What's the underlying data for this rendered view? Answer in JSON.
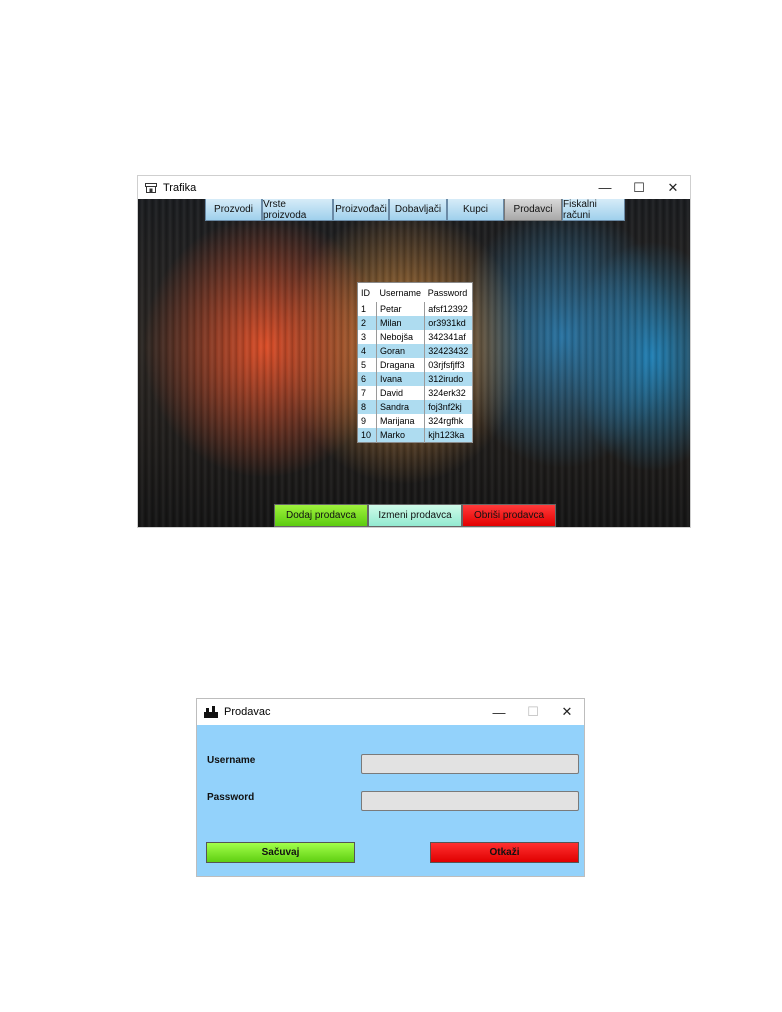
{
  "window_main": {
    "title": "Trafika",
    "controls": {
      "minimize": "—",
      "maximize": "☐",
      "close": "✕"
    },
    "tabs": [
      {
        "label": "Prozvodi",
        "active": false
      },
      {
        "label": "Vrste proizvoda",
        "active": false
      },
      {
        "label": "Proizvođači",
        "active": false
      },
      {
        "label": "Dobavljači",
        "active": false
      },
      {
        "label": "Kupci",
        "active": false
      },
      {
        "label": "Prodavci",
        "active": true
      },
      {
        "label": "Fiskalni računi",
        "active": false
      }
    ],
    "table": {
      "headers": [
        "ID",
        "Username",
        "Password"
      ],
      "rows": [
        [
          "1",
          "Petar",
          "afsf12392"
        ],
        [
          "2",
          "Milan",
          "or3931kd"
        ],
        [
          "3",
          "Nebojša",
          "342341af"
        ],
        [
          "4",
          "Goran",
          "32423432"
        ],
        [
          "5",
          "Dragana",
          "03rjfsfjff3"
        ],
        [
          "6",
          "Ivana",
          "312irudo"
        ],
        [
          "7",
          "David",
          "324erk32"
        ],
        [
          "8",
          "Sandra",
          "foj3nf2kj"
        ],
        [
          "9",
          "Marijana",
          "324rgfhk"
        ],
        [
          "10",
          "Marko",
          "kjh123ka"
        ]
      ]
    },
    "buttons": {
      "add": "Dodaj prodavca",
      "edit": "Izmeni prodavca",
      "delete": "Obriši prodavca"
    }
  },
  "window_dialog": {
    "title": "Prodavac",
    "controls": {
      "minimize": "—",
      "maximize": "☐",
      "close": "✕"
    },
    "fields": {
      "username_label": "Username",
      "username_value": "",
      "password_label": "Password",
      "password_value": ""
    },
    "buttons": {
      "save": "Sačuvaj",
      "cancel": "Otkaži"
    }
  }
}
